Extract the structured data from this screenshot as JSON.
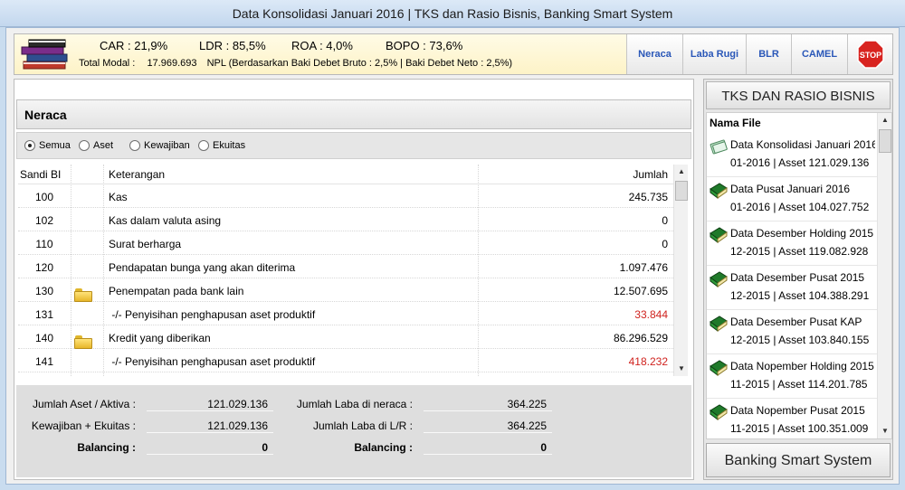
{
  "window": {
    "title": "Data Konsolidasi Januari 2016 | TKS dan Rasio Bisnis, Banking Smart System"
  },
  "header": {
    "car": "CAR : 21,9%",
    "ldr": "LDR : 85,5%",
    "roa": "ROA : 4,0%",
    "bopo": "BOPO : 73,6%",
    "total_modal_label": "Total Modal :",
    "total_modal_value": "17.969.693",
    "npl_text": "NPL (Berdasarkan Baki Debet Bruto : 2,5% | Baki Debet Neto : 2,5%)",
    "tabs": [
      "Neraca",
      "Laba Rugi",
      "BLR",
      "CAMEL"
    ],
    "stop_label": "STOP"
  },
  "neraca": {
    "title": "Neraca",
    "filters": [
      "Semua",
      "Aset",
      "Kewajiban",
      "Ekuitas"
    ],
    "selected_filter": "Semua",
    "columns": {
      "sandi": "Sandi BI",
      "keterangan": "Keterangan",
      "jumlah": "Jumlah"
    },
    "rows": [
      {
        "sandi": "100",
        "folder": false,
        "keterangan": "Kas",
        "jumlah": "245.735",
        "negative": false
      },
      {
        "sandi": "102",
        "folder": false,
        "keterangan": "Kas dalam valuta asing",
        "jumlah": "0",
        "negative": false
      },
      {
        "sandi": "110",
        "folder": false,
        "keterangan": "Surat berharga",
        "jumlah": "0",
        "negative": false
      },
      {
        "sandi": "120",
        "folder": false,
        "keterangan": "Pendapatan bunga yang akan diterima",
        "jumlah": "1.097.476",
        "negative": false
      },
      {
        "sandi": "130",
        "folder": true,
        "keterangan": "Penempatan pada bank lain",
        "jumlah": "12.507.695",
        "negative": false
      },
      {
        "sandi": "131",
        "folder": false,
        "keterangan": " -/- Penyisihan penghapusan aset produktif",
        "jumlah": "33.844",
        "negative": true
      },
      {
        "sandi": "140",
        "folder": true,
        "keterangan": "Kredit yang diberikan",
        "jumlah": "86.296.529",
        "negative": false
      },
      {
        "sandi": "141",
        "folder": false,
        "keterangan": " -/- Penyisihan penghapusan aset produktif",
        "jumlah": "418.232",
        "negative": true
      }
    ],
    "totals": {
      "jumlah_aset_label": "Jumlah Aset / Aktiva :",
      "jumlah_aset_value": "121.029.136",
      "kewajiban_ekuitas_label": "Kewajiban + Ekuitas :",
      "kewajiban_ekuitas_value": "121.029.136",
      "balancing_label": "Balancing :",
      "balancing_value": "0",
      "laba_neraca_label": "Jumlah Laba di neraca :",
      "laba_neraca_value": "364.225",
      "laba_lr_label": "Jumlah Laba di L/R :",
      "laba_lr_value": "364.225",
      "balancing2_label": "Balancing :",
      "balancing2_value": "0"
    }
  },
  "sidebar": {
    "title": "TKS DAN RASIO BISNIS",
    "list_header": "Nama File",
    "files": [
      {
        "name": "Data Konsolidasi Januari 2016",
        "line2": "01-2016 | Asset  121.029.136",
        "icon": "consolidation"
      },
      {
        "name": "Data Pusat Januari 2016",
        "line2": "01-2016 | Asset  104.027.752",
        "icon": "book"
      },
      {
        "name": "Data Desember Holding 2015",
        "line2": "12-2015 | Asset  119.082.928",
        "icon": "book"
      },
      {
        "name": "Data Desember Pusat 2015",
        "line2": "12-2015 | Asset  104.388.291",
        "icon": "book"
      },
      {
        "name": "Data Desember Pusat KAP",
        "line2": "12-2015 | Asset  103.840.155",
        "icon": "book"
      },
      {
        "name": "Data Nopember Holding 2015",
        "line2": "11-2015 | Asset  114.201.785",
        "icon": "book"
      },
      {
        "name": "Data Nopember Pusat 2015",
        "line2": "11-2015 | Asset  100.351.009",
        "icon": "book"
      }
    ],
    "footer_button": "Banking Smart System"
  }
}
